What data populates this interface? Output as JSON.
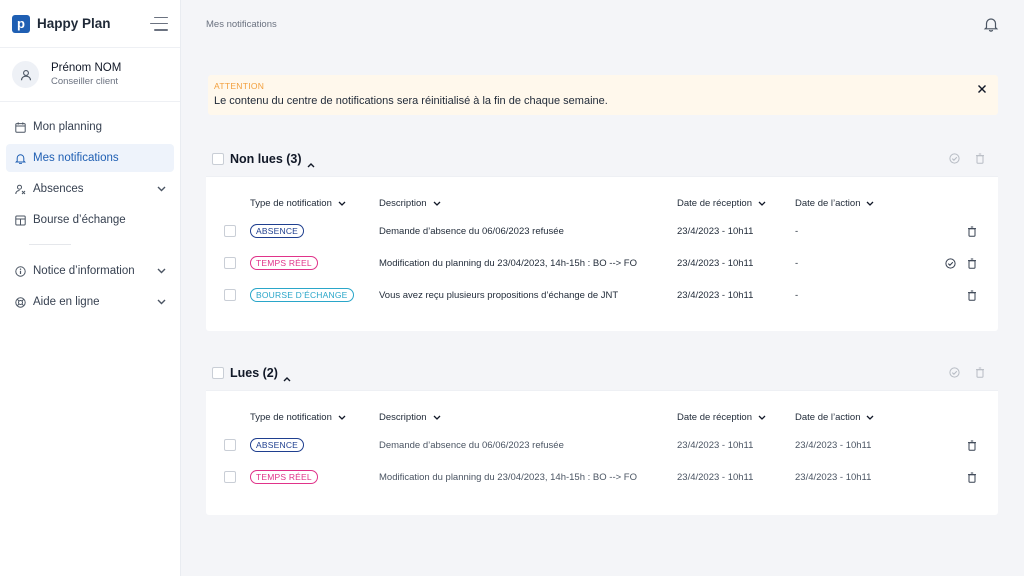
{
  "app": {
    "name": "Happy Plan",
    "logo_letter": "p"
  },
  "user": {
    "name": "Prénom NOM",
    "role": "Conseiller client"
  },
  "nav": {
    "items": [
      {
        "label": "Mon planning",
        "icon": "calendar-icon"
      },
      {
        "label": "Mes notifications",
        "icon": "bell-icon"
      },
      {
        "label": "Absences",
        "icon": "absence-icon"
      },
      {
        "label": "Bourse d’échange",
        "icon": "exchange-icon"
      }
    ],
    "items2": [
      {
        "label": "Notice d’information",
        "icon": "info-icon"
      },
      {
        "label": "Aide en ligne",
        "icon": "help-icon"
      }
    ]
  },
  "breadcrumb": "Mes notifications",
  "alert": {
    "title": "ATTENTION",
    "text": "Le contenu du centre de notifications sera réinitialisé à la fin de chaque semaine."
  },
  "unread": {
    "title": "Non lues (3)",
    "columns": [
      "Type de notification",
      "Description",
      "Date de réception",
      "Date de l’action"
    ],
    "rows": [
      {
        "type": "ABSENCE",
        "desc": "Demande d’absence du 06/06/2023 refusée",
        "received": "23/4/2023 - 10h11",
        "action": "-"
      },
      {
        "type": "TEMPS RÉEL",
        "desc": "Modification du planning du 23/04/2023, 14h-15h : BO --> FO",
        "received": "23/4/2023 - 10h11",
        "action": "-"
      },
      {
        "type": "BOURSE D’ÉCHANGE",
        "desc": "Vous avez reçu plusieurs propositions d’échange de JNT",
        "received": "23/4/2023 - 10h11",
        "action": "-"
      }
    ]
  },
  "read": {
    "title": "Lues (2)",
    "columns": [
      "Type de notification",
      "Description",
      "Date de réception",
      "Date de l’action"
    ],
    "rows": [
      {
        "type": "ABSENCE",
        "desc": "Demande d’absence du 06/06/2023 refusée",
        "received": "23/4/2023 - 10h11",
        "action": "23/4/2023 - 10h11"
      },
      {
        "type": "TEMPS RÉEL",
        "desc": "Modification du planning du 23/04/2023, 14h-15h : BO --> FO",
        "received": "23/4/2023 - 10h11",
        "action": "23/4/2023 - 10h11"
      }
    ]
  },
  "colors": {
    "primary": "#1f5fb3",
    "absence": "#1f3f8f",
    "temps_reel": "#e0338a",
    "bourse": "#2aa6c9",
    "alert_bg": "#fff8ec",
    "alert_title": "#f29f3d"
  }
}
